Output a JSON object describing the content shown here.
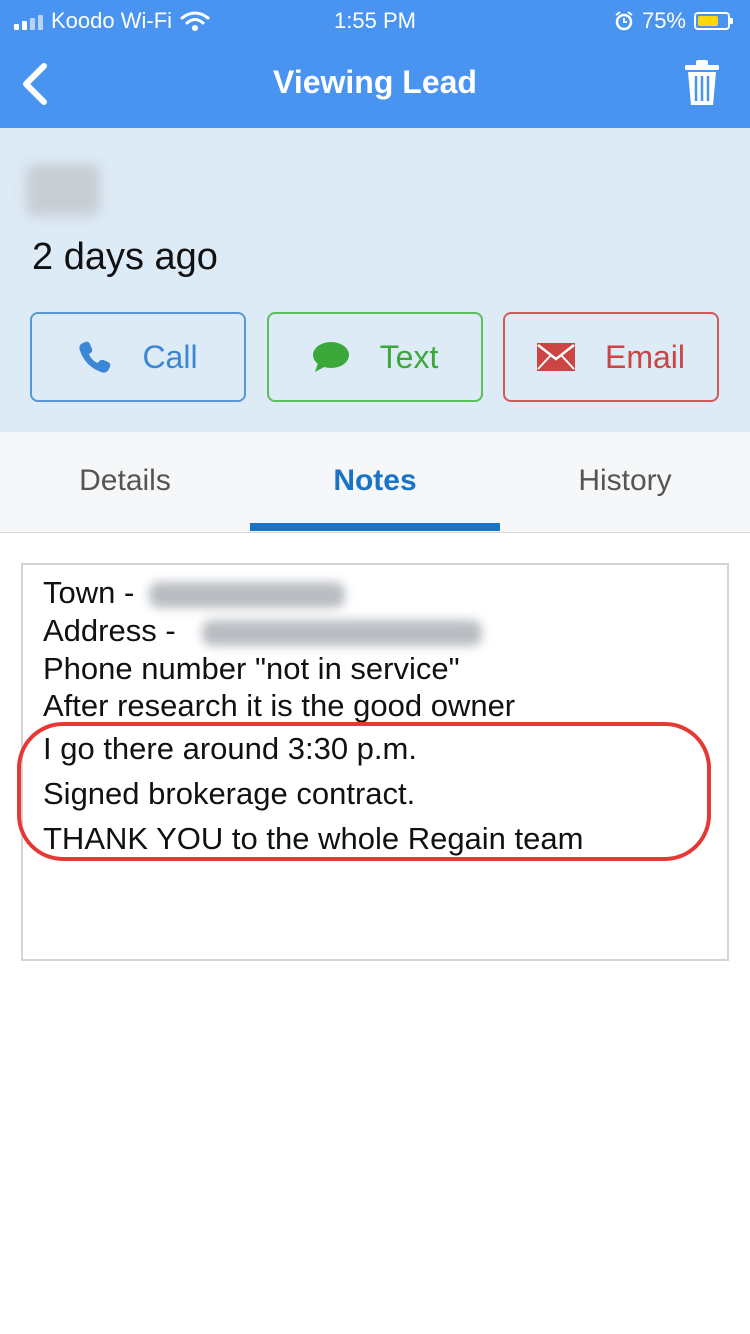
{
  "status_bar": {
    "carrier": "Koodo Wi-Fi",
    "time": "1:55 PM",
    "battery_percent": "75%",
    "battery_level": 0.75,
    "battery_color": "#ffd60a"
  },
  "nav": {
    "title": "Viewing Lead",
    "back_icon": "chevron-left-icon",
    "delete_icon": "trash-icon"
  },
  "lead": {
    "name": "",
    "time_ago": "2 days ago"
  },
  "actions": {
    "call": "Call",
    "text": "Text",
    "email": "Email"
  },
  "tabs": [
    {
      "label": "Details"
    },
    {
      "label": "Notes",
      "active": true
    },
    {
      "label": "History"
    }
  ],
  "notes": {
    "town_label": "Town -",
    "address_label": "Address -",
    "line3": "Phone number \"not in service\"",
    "line4": "After research it is the good owner",
    "line5": "I go there around 3:30 p.m.",
    "line6": "Signed brokerage contract.",
    "line7": "THANK YOU to the whole Regain team"
  },
  "colors": {
    "accent": "#4a94f1",
    "tab_active": "#1b73c6",
    "call": "#3b87d6",
    "text": "#3aa93a",
    "email": "#cc4444",
    "highlight": "#e53935"
  }
}
